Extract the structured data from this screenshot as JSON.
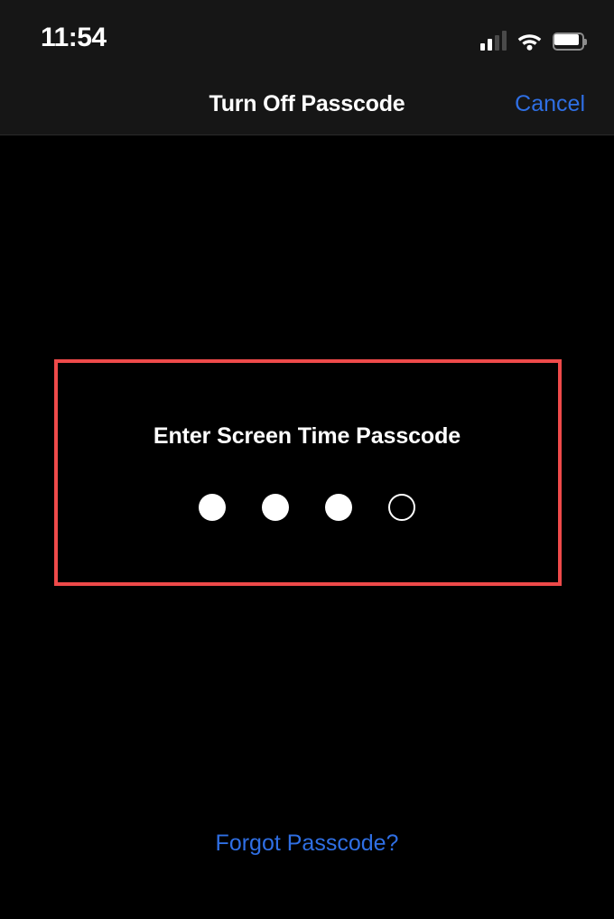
{
  "status_bar": {
    "time": "11:54",
    "cellular_icon": "cellular-signal-icon",
    "cellular_bars_total": 4,
    "cellular_bars_active": 2,
    "wifi_icon": "wifi-icon",
    "battery_icon": "battery-icon",
    "battery_level_percent": 90
  },
  "nav_bar": {
    "title": "Turn Off Passcode",
    "cancel_label": "Cancel"
  },
  "main": {
    "prompt_title": "Enter Screen Time Passcode",
    "passcode_length": 4,
    "passcode_entered": 3,
    "dots": [
      {
        "state": "filled"
      },
      {
        "state": "filled"
      },
      {
        "state": "filled"
      },
      {
        "state": "empty"
      }
    ],
    "forgot_passcode_label": "Forgot Passcode?"
  },
  "annotation": {
    "highlight_box_label": "red-highlight-box"
  },
  "colors": {
    "background": "#000000",
    "bar_background": "#161616",
    "accent_blue": "#2f6fe4",
    "highlight_red": "#ef4a4a",
    "text_primary": "#ffffff",
    "signal_inactive": "#4a4a4a"
  }
}
